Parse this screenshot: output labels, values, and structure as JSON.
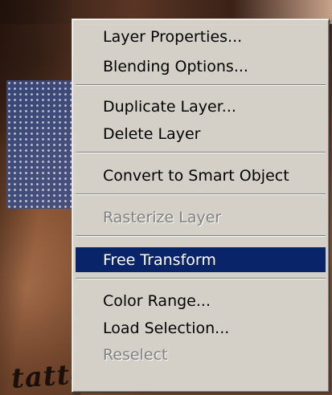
{
  "background": {
    "watermark_text": "tattoo"
  },
  "context_menu": {
    "selected_color": "#0a246a",
    "items": [
      {
        "label": "Layer Properties...",
        "enabled": true,
        "selected": false
      },
      {
        "label": "Blending Options...",
        "enabled": true,
        "selected": false
      },
      {
        "label": "Duplicate Layer...",
        "enabled": true,
        "selected": false
      },
      {
        "label": "Delete Layer",
        "enabled": true,
        "selected": false
      },
      {
        "label": "Convert to Smart Object",
        "enabled": true,
        "selected": false
      },
      {
        "label": "Rasterize Layer",
        "enabled": false,
        "selected": false
      },
      {
        "label": "Free Transform",
        "enabled": true,
        "selected": true
      },
      {
        "label": "Color Range...",
        "enabled": true,
        "selected": false
      },
      {
        "label": "Load Selection...",
        "enabled": true,
        "selected": false
      },
      {
        "label": "Reselect",
        "enabled": false,
        "selected": false
      }
    ]
  }
}
